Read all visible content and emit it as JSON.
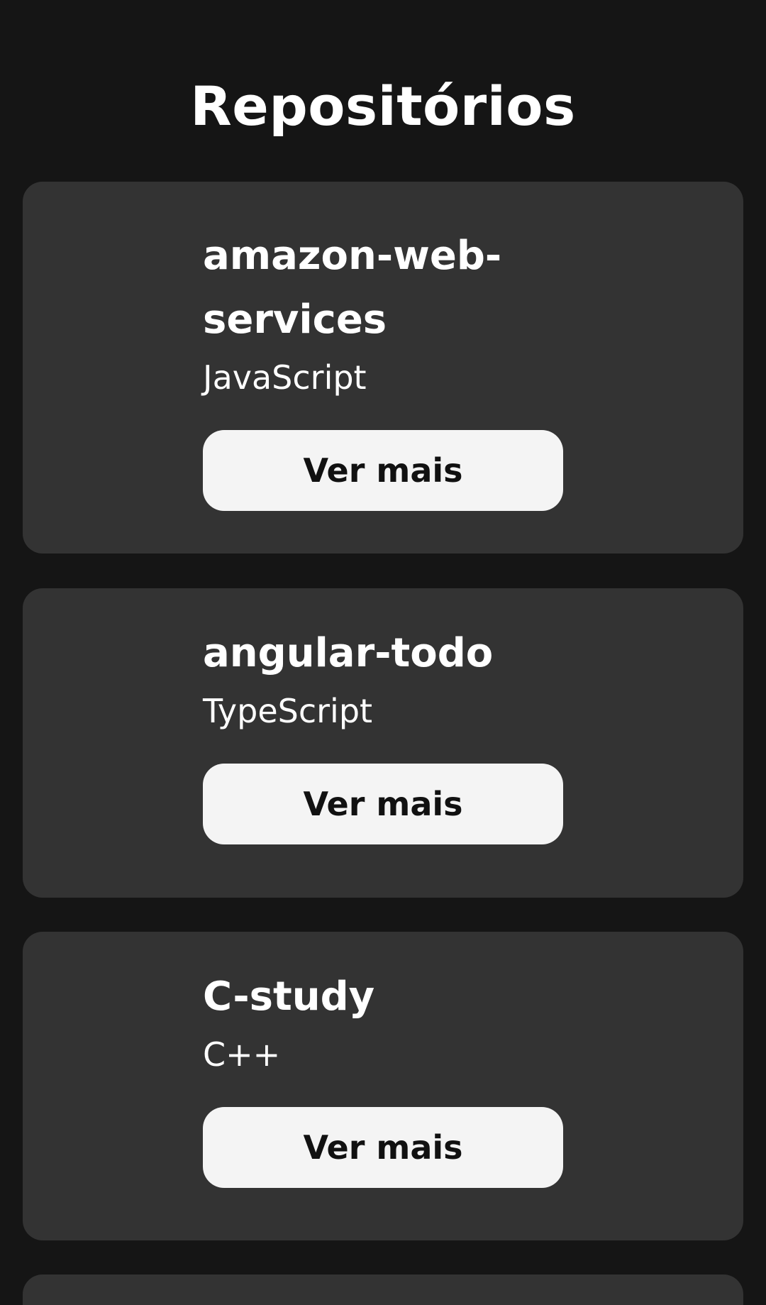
{
  "page": {
    "title": "Repositórios"
  },
  "repositories": [
    {
      "name": "amazon-web-services",
      "language": "JavaScript",
      "button_label": "Ver mais"
    },
    {
      "name": "angular-todo",
      "language": "TypeScript",
      "button_label": "Ver mais"
    },
    {
      "name": "C-study",
      "language": "C++",
      "button_label": "Ver mais"
    }
  ],
  "colors": {
    "background": "#151515",
    "card": "#333333",
    "button": "#f4f4f4",
    "button_text": "#111111",
    "text": "#ffffff"
  }
}
